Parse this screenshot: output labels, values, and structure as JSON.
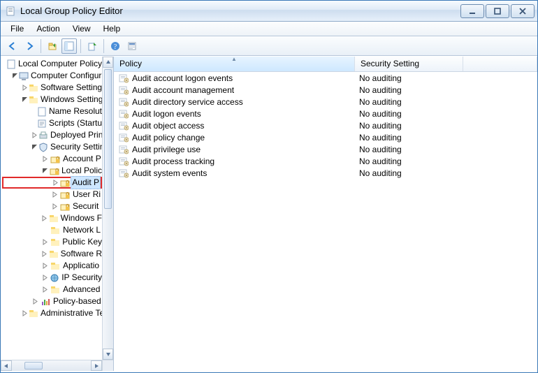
{
  "window": {
    "title": "Local Group Policy Editor"
  },
  "menubar": {
    "file": "File",
    "action": "Action",
    "view": "View",
    "help": "Help"
  },
  "tree": {
    "root": "Local Computer Policy",
    "computer_config": "Computer Configura",
    "software_settings": "Software Settings",
    "windows_settings": "Windows Settings",
    "name_resolution": "Name Resolut",
    "scripts": "Scripts (Startu",
    "deployed_printers": "Deployed Prin",
    "security_settings": "Security Settin",
    "account_policies": "Account P",
    "local_policies": "Local Polic",
    "audit_policy": "Audit P",
    "user_rights": "User Ri",
    "security_options": "Securit",
    "windows_firewall": "Windows F",
    "network_list": "Network L",
    "public_key": "Public Key",
    "software_restrict": "Software R",
    "app_ctrl": "Applicatio",
    "ip_security": "IP Security",
    "advanced": "Advanced",
    "policy_based": "Policy-based",
    "admin_templates": "Administrative Te"
  },
  "columns": {
    "policy": "Policy",
    "setting": "Security Setting"
  },
  "policies": [
    {
      "name": "Audit account logon events",
      "setting": "No auditing"
    },
    {
      "name": "Audit account management",
      "setting": "No auditing"
    },
    {
      "name": "Audit directory service access",
      "setting": "No auditing"
    },
    {
      "name": "Audit logon events",
      "setting": "No auditing"
    },
    {
      "name": "Audit object access",
      "setting": "No auditing"
    },
    {
      "name": "Audit policy change",
      "setting": "No auditing"
    },
    {
      "name": "Audit privilege use",
      "setting": "No auditing"
    },
    {
      "name": "Audit process tracking",
      "setting": "No auditing"
    },
    {
      "name": "Audit system events",
      "setting": "No auditing"
    }
  ]
}
